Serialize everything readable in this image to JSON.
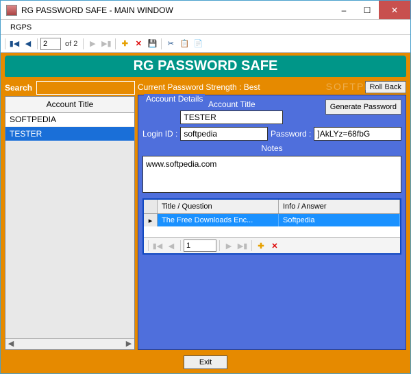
{
  "window": {
    "title": "RG PASSWORD SAFE - MAIN WINDOW"
  },
  "menu": {
    "item1": "RGPS"
  },
  "toolbar": {
    "page": "2",
    "of": "of 2"
  },
  "app": {
    "title": "RG PASSWORD SAFE"
  },
  "search": {
    "label": "Search"
  },
  "grid": {
    "header": "Account Title",
    "rows": [
      "SOFTPEDIA",
      "TESTER"
    ]
  },
  "strength": {
    "label": "Current Password Strength : Best",
    "rollback": "Roll Back"
  },
  "details": {
    "group": "Account Details",
    "title_label": "Account Title",
    "title_value": "TESTER",
    "gen_button": "Generate Password",
    "login_label": "Login ID :",
    "login_value": "softpedia",
    "password_label": "Password :",
    "password_value": "]AkLYz=68fbG",
    "notes_label": "Notes",
    "notes_value": "www.softpedia.com"
  },
  "subgrid": {
    "col1": "Title / Question",
    "col2": "Info / Answer",
    "row1_col1": "The Free Downloads Enc...",
    "row1_col2": "Softpedia",
    "page": "1"
  },
  "footer": {
    "exit": "Exit"
  },
  "watermark": "SOFTPEDIA"
}
